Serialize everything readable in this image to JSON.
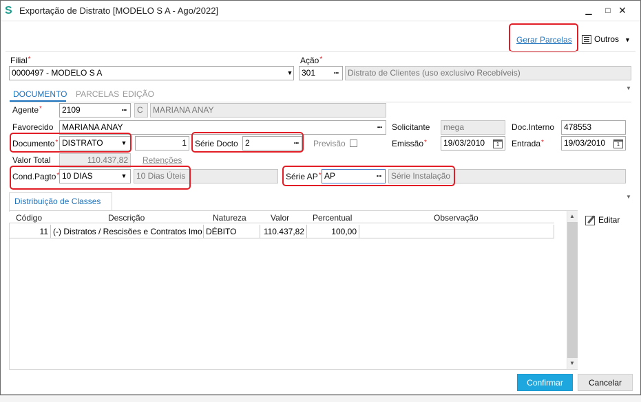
{
  "window": {
    "title": "Exportação de Distrato [MODELO S A - Ago/2022]",
    "minimize_glyph": "▁",
    "maximize_glyph": "□",
    "close_glyph": "✕"
  },
  "toolbar": {
    "gerar_parcelas": "Gerar Parcelas",
    "outros": "Outros"
  },
  "header": {
    "filial_label": "Filial",
    "filial_value": "0000497 - MODELO S A",
    "acao_label": "Ação",
    "acao_code": "301",
    "acao_desc": "Distrato de Clientes (uso exclusivo Recebíveis)"
  },
  "tabs": [
    {
      "label": "DOCUMENTO",
      "active": true
    },
    {
      "label": "PARCELAS",
      "active": false
    },
    {
      "label": "EDIÇÃO",
      "active": false
    }
  ],
  "form": {
    "agente_label": "Agente",
    "agente_code": "2109",
    "agente_type": "C",
    "agente_name": "MARIANA ANAY",
    "favorecido_label": "Favorecido",
    "favorecido_value": "MARIANA ANAY",
    "solicitante_label": "Solicitante",
    "solicitante_value": "mega",
    "doc_interno_label": "Doc.Interno",
    "doc_interno_value": "478553",
    "documento_label": "Documento",
    "documento_value": "DISTRATO",
    "documento_num": "1",
    "serie_docto_label": "Série Docto",
    "serie_docto_value": "2",
    "previsao_label": "Previsão",
    "emissao_label": "Emissão",
    "emissao_value": "19/03/2010",
    "entrada_label": "Entrada",
    "entrada_value": "19/03/2010",
    "valor_total_label": "Valor Total",
    "valor_total_value": "110.437,82",
    "retencoes_label": "Retenções",
    "cond_pagto_label": "Cond.Pagto",
    "cond_pagto_value": "10 DIAS",
    "cond_pagto_desc": "10 Dias Úteis",
    "serie_ap_label": "Série AP",
    "serie_ap_value": "AP",
    "serie_instalacao": "Série Instalação"
  },
  "subtab": {
    "label": "Distribuição de Classes"
  },
  "grid": {
    "columns": [
      "Código",
      "Descrição",
      "Natureza",
      "Valor",
      "Percentual",
      "Observação"
    ],
    "rows": [
      {
        "codigo": "11",
        "descricao": "(-) Distratos / Rescisões e Contratos Imo",
        "natureza": "DÉBITO",
        "valor": "110.437,82",
        "percentual": "100,00",
        "observacao": ""
      }
    ]
  },
  "side": {
    "editar": "Editar"
  },
  "buttons": {
    "confirmar": "Confirmar",
    "cancelar": "Cancelar"
  }
}
